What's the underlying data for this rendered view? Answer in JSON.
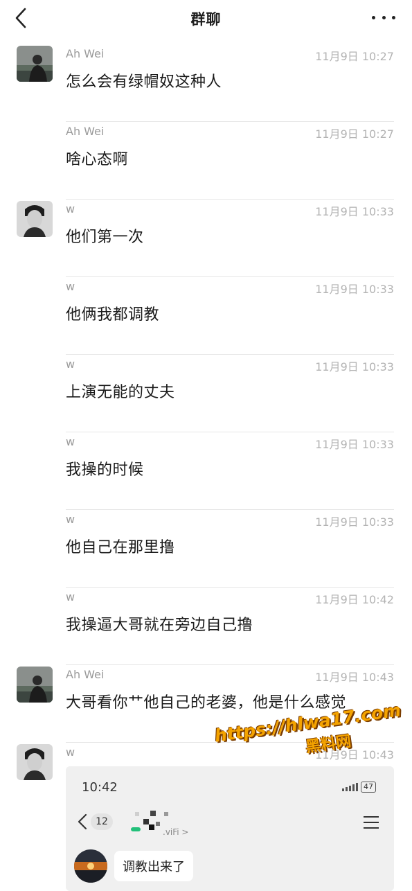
{
  "header": {
    "title": "群聊",
    "back_icon": "chevron-left-icon",
    "more_icon": "more-dots-icon"
  },
  "messages": [
    {
      "sender": "Ah Wei",
      "time": "11月9日 10:27",
      "text": "怎么会有绿帽奴这种人"
    },
    {
      "sender": "Ah Wei",
      "time": "11月9日 10:27",
      "text": "啥心态啊"
    },
    {
      "sender": "w",
      "time": "11月9日 10:33",
      "text": "他们第一次"
    },
    {
      "sender": "w",
      "time": "11月9日 10:33",
      "text": "他俩我都调教"
    },
    {
      "sender": "w",
      "time": "11月9日 10:33",
      "text": "上演无能的丈夫"
    },
    {
      "sender": "w",
      "time": "11月9日 10:33",
      "text": "我操的时候"
    },
    {
      "sender": "w",
      "time": "11月9日 10:33",
      "text": "他自己在那里撸"
    },
    {
      "sender": "w",
      "time": "11月9日 10:42",
      "text": "我操逼大哥就在旁边自己撸"
    },
    {
      "sender": "Ah Wei",
      "time": "11月9日 10:43",
      "text": "大哥看你艹他自己的老婆，他是什么感觉"
    },
    {
      "sender": "w",
      "time": "11月9日 10:43",
      "text": ""
    }
  ],
  "embedded_screenshot": {
    "time": "10:42",
    "battery": "47",
    "badge": "12",
    "wifi_label": ".viFi >",
    "bubble_text": "调教出来了"
  },
  "watermark": {
    "url": "https://hlwa17.com",
    "label": "黑料网"
  },
  "colors": {
    "background": "#ffffff",
    "meta_text": "#9a9a9a",
    "divider": "#e6e6e6",
    "watermark": "#f4a300"
  }
}
